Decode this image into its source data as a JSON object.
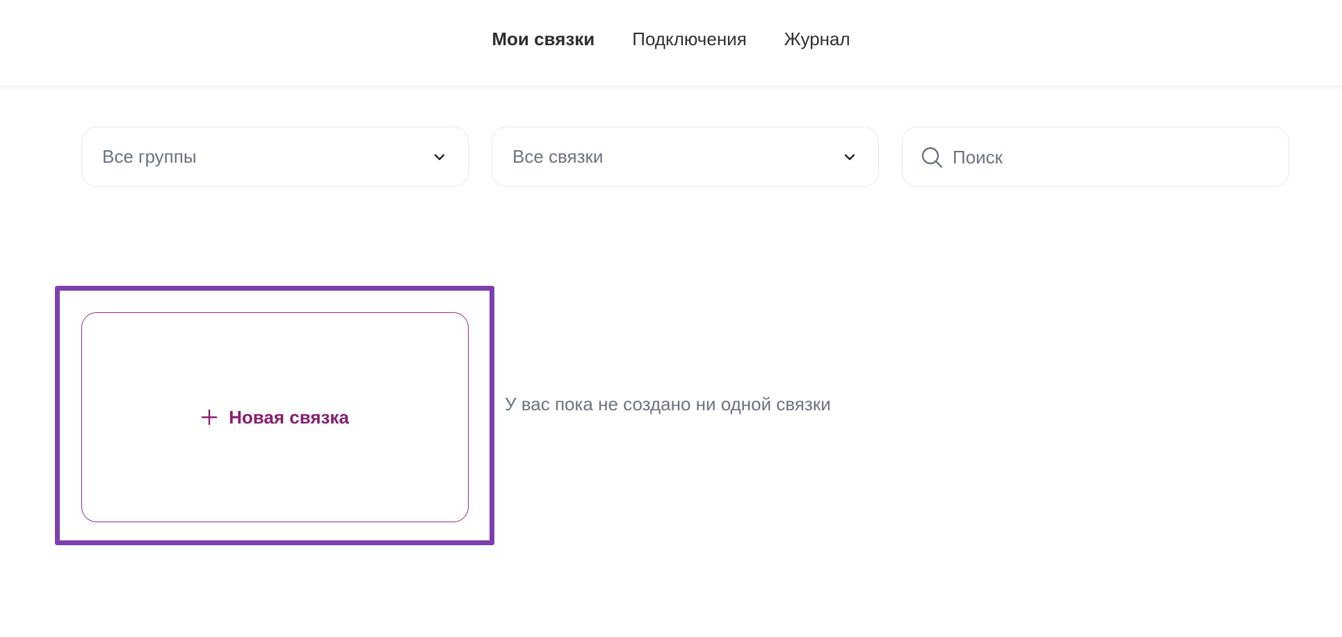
{
  "nav": {
    "items": [
      {
        "label": "Мои связки",
        "active": true
      },
      {
        "label": "Подключения",
        "active": false
      },
      {
        "label": "Журнал",
        "active": false
      }
    ]
  },
  "filters": {
    "groups": {
      "value": "Все группы",
      "icon": "chevron-down-icon"
    },
    "links": {
      "value": "Все связки",
      "icon": "chevron-down-icon"
    },
    "search": {
      "placeholder": "Поиск",
      "value": "",
      "icon": "search-icon"
    }
  },
  "new_card": {
    "label": "Новая связка",
    "icon": "plus-icon"
  },
  "empty_state": {
    "text": "У вас пока не создано ни одной связки"
  },
  "colors": {
    "accent": "#861e6f",
    "highlight": "#7d3fad",
    "muted_text": "#6c7283",
    "primary_text": "#2b2e31",
    "border": "#e6e8ee"
  }
}
